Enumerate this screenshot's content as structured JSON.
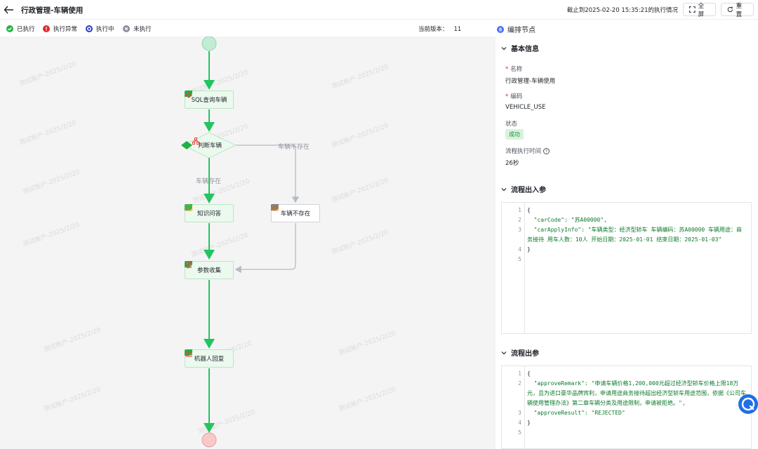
{
  "header": {
    "title": "行政管理-车辆使用",
    "exec_time": "截止到2025-02-20 15:35:21的执行情况",
    "fullscreen_label": "全屏",
    "reset_label": "重置"
  },
  "legend": {
    "items": [
      {
        "label": "已执行",
        "color": "#22b44a"
      },
      {
        "label": "执行异常",
        "color": "#e02b2b"
      },
      {
        "label": "执行中",
        "color": "#2d39c4"
      },
      {
        "label": "未执行",
        "color": "#8a8f99"
      }
    ],
    "version_label": "当前版本：",
    "version_value": "11"
  },
  "flow": {
    "nodes": {
      "sql": "SQL查询车辆",
      "judge": "判断车辆",
      "qa": "知识问答",
      "not_exist": "车辆不存在",
      "params": "参数收集",
      "bot": "机器人回复"
    },
    "edge_labels": {
      "not_exist": "车辆不存在",
      "exists": "车辆存在"
    },
    "watermark": "测试账户-2025/2/20"
  },
  "panel": {
    "title": "编排节点",
    "basic": {
      "title": "基本信息",
      "name_label": "名称",
      "name_value": "行政管理-车辆使用",
      "code_label": "编码",
      "code_value": "VEHICLE_USE",
      "status_label": "状态",
      "status_value": "成功",
      "duration_label": "流程执行时间",
      "duration_value": "26秒"
    },
    "inout": {
      "title": "流程出入参",
      "line_numbers": [
        "1",
        "2",
        "3",
        "4",
        "5"
      ],
      "lines": [
        "{",
        "  \"carCode\": \"苏A00000\",",
        "  \"carApplyInfo\": \"车辆类型：经济型轿车 车辆编码：苏A00000 车辆用途：商务接待 用车人数：10人 开始日期：2025-01-01 结束日期：2025-01-03\"",
        "}",
        ""
      ]
    },
    "output": {
      "title": "流程出参",
      "line_numbers": [
        "1",
        "2",
        "3",
        "4",
        "5"
      ],
      "lines": [
        "{",
        "  \"approveRemark\": \"申请车辆价格1,200,000元超过经济型轿车价格上限18万元，且为进口豪华品牌宾利，申请用途商务接待超出经济型轿车用途范围，依据《公司车辆使用管理办法》第二章车辆分类及用途限制，申请被拒绝。\",",
        "  \"approveResult\": \"REJECTED\"",
        "}",
        ""
      ]
    }
  }
}
